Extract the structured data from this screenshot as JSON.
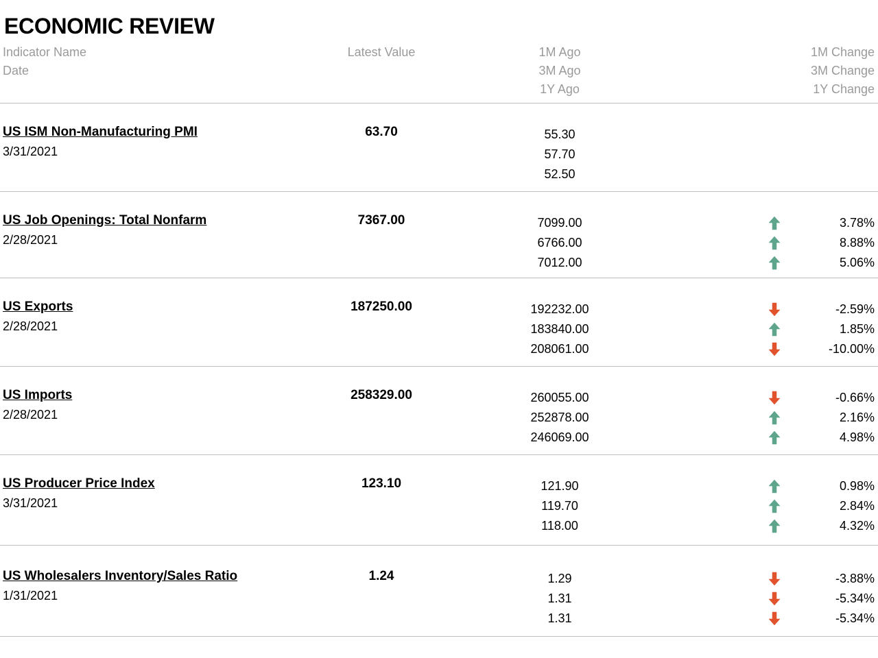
{
  "title": "ECONOMIC REVIEW",
  "headers": {
    "indicator_name": "Indicator Name",
    "date": "Date",
    "latest_value": "Latest Value",
    "ago_1m": "1M Ago",
    "ago_3m": "3M Ago",
    "ago_1y": "1Y Ago",
    "change_1m": "1M Change",
    "change_3m": "3M Change",
    "change_1y": "1Y Change"
  },
  "colors": {
    "up": "#5fa58c",
    "down": "#e0532d",
    "header_text": "#9a9a9a"
  },
  "indicators": [
    {
      "name": "US ISM Non-Manufacturing PMI",
      "date": "3/31/2021",
      "latest": "63.70",
      "ago": [
        "55.30",
        "57.70",
        "52.50"
      ],
      "changes": []
    },
    {
      "name": "US Job Openings: Total Nonfarm",
      "date": "2/28/2021",
      "latest": "7367.00",
      "ago": [
        "7099.00",
        "6766.00",
        "7012.00"
      ],
      "changes": [
        {
          "value": "3.78%",
          "dir": "up"
        },
        {
          "value": "8.88%",
          "dir": "up"
        },
        {
          "value": "5.06%",
          "dir": "up"
        }
      ]
    },
    {
      "name": "US Exports",
      "date": "2/28/2021",
      "latest": "187250.00",
      "ago": [
        "192232.00",
        "183840.00",
        "208061.00"
      ],
      "changes": [
        {
          "value": "-2.59%",
          "dir": "down"
        },
        {
          "value": "1.85%",
          "dir": "up"
        },
        {
          "value": "-10.00%",
          "dir": "down"
        }
      ]
    },
    {
      "name": "US Imports",
      "date": "2/28/2021",
      "latest": "258329.00",
      "ago": [
        "260055.00",
        "252878.00",
        "246069.00"
      ],
      "changes": [
        {
          "value": "-0.66%",
          "dir": "down"
        },
        {
          "value": "2.16%",
          "dir": "up"
        },
        {
          "value": "4.98%",
          "dir": "up"
        }
      ]
    },
    {
      "name": "US Producer Price Index",
      "date": "3/31/2021",
      "latest": "123.10",
      "ago": [
        "121.90",
        "119.70",
        "118.00"
      ],
      "changes": [
        {
          "value": "0.98%",
          "dir": "up"
        },
        {
          "value": "2.84%",
          "dir": "up"
        },
        {
          "value": "4.32%",
          "dir": "up"
        }
      ]
    },
    {
      "name": "US Wholesalers Inventory/Sales Ratio",
      "date": "1/31/2021",
      "latest": "1.24",
      "ago": [
        "1.29",
        "1.31",
        "1.31"
      ],
      "changes": [
        {
          "value": "-3.88%",
          "dir": "down"
        },
        {
          "value": "-5.34%",
          "dir": "down"
        },
        {
          "value": "-5.34%",
          "dir": "down"
        }
      ]
    }
  ]
}
